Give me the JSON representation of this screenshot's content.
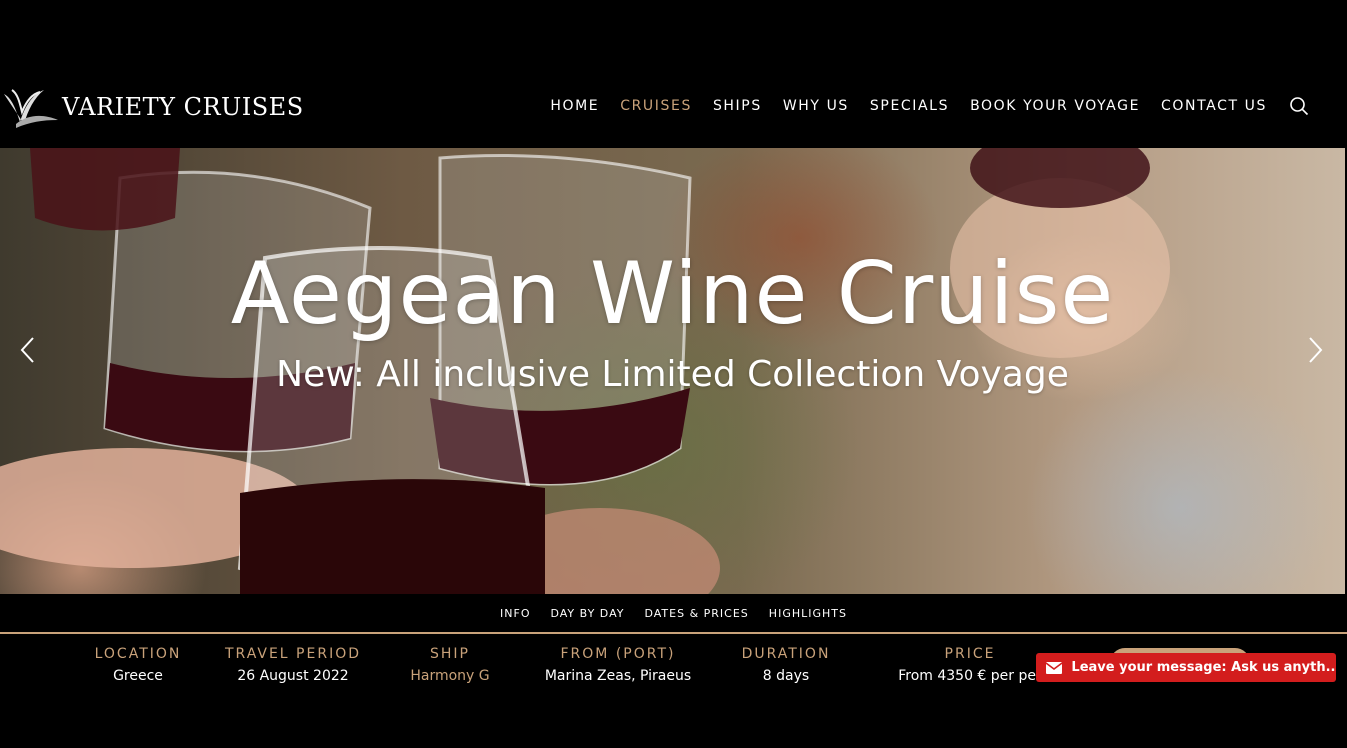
{
  "brand": {
    "name": "VARIETY CRUISES",
    "accent_color": "#c9a27a"
  },
  "nav": {
    "items": [
      {
        "label": "HOME",
        "active": false
      },
      {
        "label": "CRUISES",
        "active": true
      },
      {
        "label": "SHIPS",
        "active": false
      },
      {
        "label": "WHY US",
        "active": false
      },
      {
        "label": "SPECIALS",
        "active": false
      },
      {
        "label": "BOOK YOUR VOYAGE",
        "active": false
      },
      {
        "label": "CONTACT US",
        "active": false
      }
    ],
    "search_icon": "search-icon"
  },
  "hero": {
    "title": "Aegean Wine Cruise",
    "subtitle": "New: All inclusive Limited Collection Voyage",
    "prev_icon": "chevron-left-icon",
    "next_icon": "chevron-right-icon"
  },
  "tabs": [
    "INFO",
    "DAY BY DAY",
    "DATES & PRICES",
    "HIGHLIGHTS"
  ],
  "info": {
    "location": {
      "label": "LOCATION",
      "value": "Greece"
    },
    "travel_period": {
      "label": "TRAVEL PERIOD",
      "value": "26 August 2022"
    },
    "ship": {
      "label": "SHIP",
      "value": "Harmony G"
    },
    "from_port": {
      "label": "FROM (PORT)",
      "value": "Marina Zeas, Piraeus"
    },
    "duration": {
      "label": "DURATION",
      "value": "8 days"
    },
    "price": {
      "label": "PRICE",
      "value": "From 4350 € per per"
    }
  },
  "chat": {
    "text": "Leave your message: Ask us anyth...",
    "icon": "envelope-icon",
    "color": "#d31d1d"
  }
}
